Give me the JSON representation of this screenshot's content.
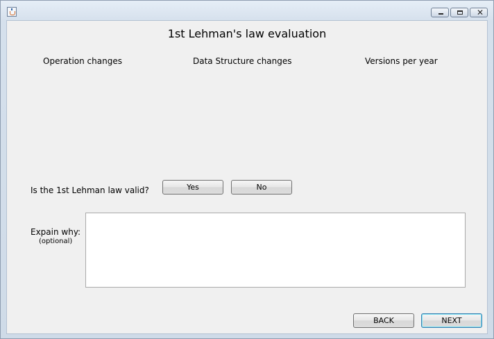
{
  "window": {
    "controls": {
      "minimize_icon": "minimize-icon",
      "maximize_icon": "maximize-icon",
      "close_icon": "close-icon"
    }
  },
  "page": {
    "title": "1st Lehman's law evaluation",
    "columns": [
      "Operation changes",
      "Data Structure changes",
      "Versions per year"
    ]
  },
  "question": {
    "label": "Is the 1st Lehman law valid?",
    "yes_label": "Yes",
    "no_label": "No"
  },
  "explain": {
    "label": "Expain why:",
    "optional": "(optional)",
    "value": ""
  },
  "nav": {
    "back_label": "BACK",
    "next_label": "NEXT"
  }
}
